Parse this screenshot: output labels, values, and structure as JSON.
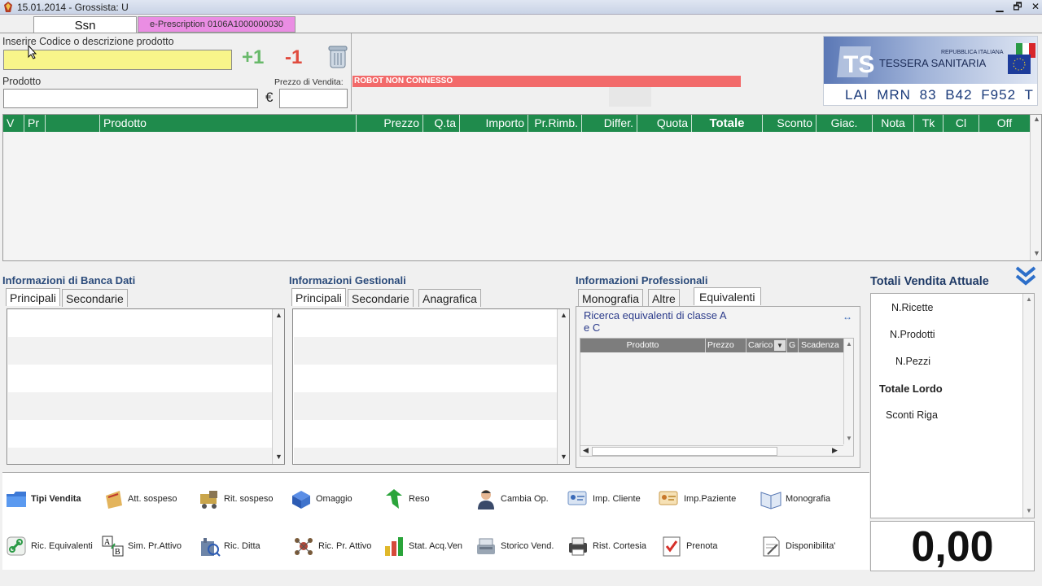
{
  "titlebar": {
    "title": "15.01.2014 - Grossista: U",
    "minimize": "▁",
    "restore": "🗗",
    "close": "✕"
  },
  "tabs": {
    "ssn": "Ssn",
    "eprescription": "e-Prescription 0106A1000000030"
  },
  "search": {
    "label": "Inserire Codice o descrizione prodotto",
    "value": "",
    "plus_one": "+1",
    "minus_one": "-1"
  },
  "product": {
    "label": "Prodotto",
    "value": "",
    "price_label": "Prezzo di Vendita:",
    "currency": "€",
    "price_value": ""
  },
  "robot_status": "ROBOT NON CONNESSO",
  "ts_card": {
    "republic": "REPUBBLICA ITALIANA",
    "title": "TESSERA SANITARIA",
    "code": "LAI MRN 83 B42 F952 T"
  },
  "grid": {
    "columns": [
      "V",
      "Pr",
      "",
      "Prodotto",
      "Prezzo",
      "Q.ta",
      "Importo",
      "Pr.Rimb.",
      "Differ.",
      "Quota",
      "Totale",
      "Sconto",
      "Giac.",
      "Nota",
      "Tk",
      "Cl",
      "Off"
    ]
  },
  "sections": {
    "banca_dati": {
      "title": "Informazioni di Banca Dati",
      "tabs": [
        "Principali",
        "Secondarie"
      ]
    },
    "gestionali": {
      "title": "Informazioni Gestionali",
      "tabs": [
        "Principali",
        "Secondarie",
        "Anagrafica"
      ]
    },
    "professionali": {
      "title": "Informazioni Professionali",
      "tabs": [
        "Monografia",
        "Altre",
        "Equivalenti"
      ],
      "equiv_title_1": "Ricerca equivalenti di classe A",
      "equiv_title_2": "e C",
      "columns": [
        "Prodotto",
        "Prezzo",
        "Carico",
        "G",
        "Scadenza"
      ]
    }
  },
  "totals": {
    "title": "Totali Vendita Attuale",
    "items": [
      "N.Ricette",
      "N.Prodotti",
      "N.Pezzi",
      "Totale Lordo",
      "Sconti Riga"
    ],
    "amount": "0,00"
  },
  "buttons": {
    "row1": [
      "Tipi Vendita",
      "Att. sospeso",
      "Rit. sospeso",
      "Omaggio",
      "Reso",
      "Cambia Op.",
      "Imp. Cliente",
      "Imp.Paziente",
      "Monografia"
    ],
    "row2": [
      "Ric. Equivalenti",
      "Sim. Pr.Attivo",
      "Ric. Ditta",
      "Ric. Pr. Attivo",
      "Stat. Acq.Ven",
      "Storico Vend.",
      "Rist. Cortesia",
      "Prenota",
      "Disponibilita'"
    ]
  },
  "colors": {
    "grid_header": "#1f8b4c",
    "robot": "#f26a6a",
    "search_input": "#f8f58a",
    "eprescription_tab": "#ea8de3"
  }
}
